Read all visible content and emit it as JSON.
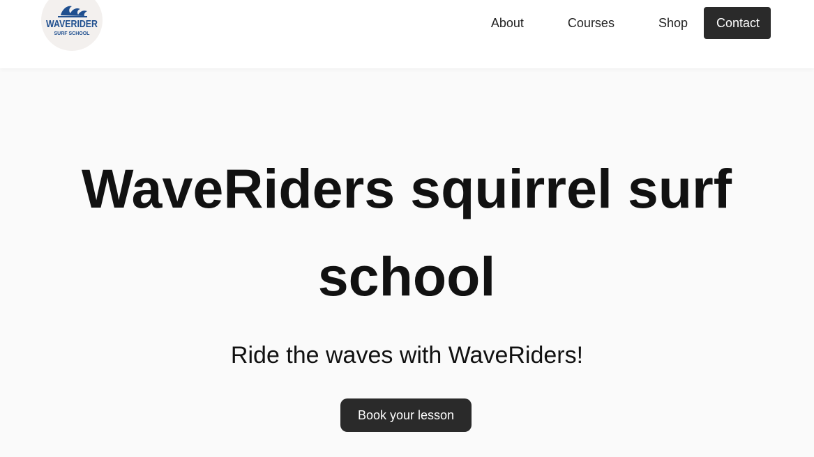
{
  "brand": {
    "logo_text": "WAVERIDER",
    "logo_subtext": "SURF SCHOOL",
    "accent_color": "#1f4f8f",
    "logo_icon": "wave-icon"
  },
  "nav": {
    "items": [
      {
        "label": "About"
      },
      {
        "label": "Courses"
      },
      {
        "label": "Shop"
      }
    ],
    "contact_label": "Contact"
  },
  "hero": {
    "title": "WaveRiders squirrel surf school",
    "subtitle": "Ride the waves with WaveRiders!",
    "cta_label": "Book your lesson"
  },
  "colors": {
    "page_bg": "#fafafa",
    "header_bg": "#ffffff",
    "button_bg": "#2a2a2a",
    "button_text": "#ffffff"
  }
}
